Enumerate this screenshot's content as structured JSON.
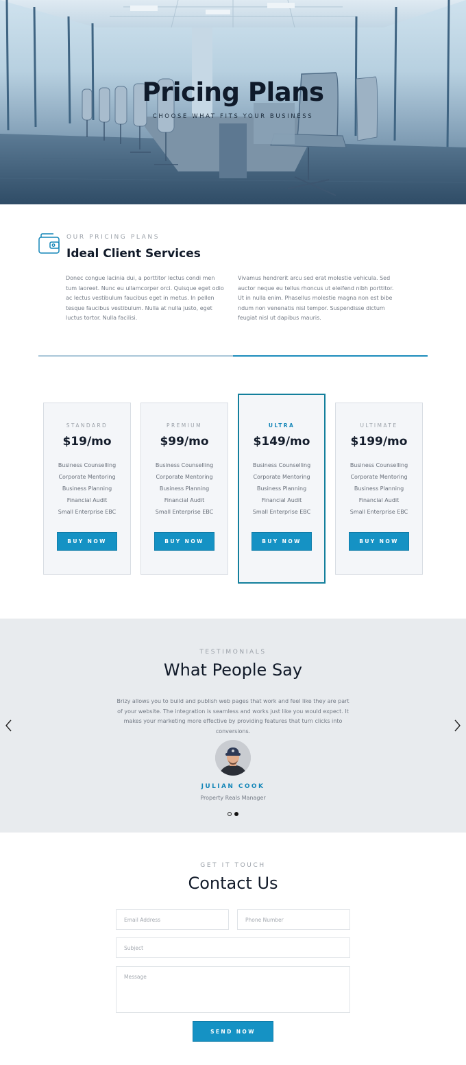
{
  "hero": {
    "title": "Pricing Plans",
    "subtitle": "CHOOSE WHAT FITS YOUR BUSINESS"
  },
  "services": {
    "icon": "wallet-icon",
    "eyebrow": "OUR PRICING PLANS",
    "title": "Ideal Client Services",
    "paragraph_left": "Donec congue lacinia dui, a porttitor lectus condi men tum laoreet. Nunc eu ullamcorper orci. Quisque eget odio ac lectus vestibulum faucibus eget in metus. In pellen tesque faucibus vestibulum. Nulla at nulla justo, eget luctus tortor. Nulla facilisi.",
    "paragraph_right": "Vivamus hendrerit arcu sed erat molestie vehicula. Sed auctor neque eu tellus rhoncus ut eleifend nibh porttitor. Ut in nulla enim. Phasellus molestie magna non est bibe ndum non venenatis nisl tempor. Suspendisse dictum feugiat nisl ut dapibus mauris."
  },
  "pricing": {
    "plans": [
      {
        "name": "STANDARD",
        "price": "$19/mo",
        "features": [
          "Business Counselling",
          "Corporate Mentoring",
          "Business Planning",
          "Financial Audit",
          "Small Enterprise EBC"
        ],
        "button": "BUY NOW"
      },
      {
        "name": "PREMIUM",
        "price": "$99/mo",
        "features": [
          "Business Counselling",
          "Corporate Mentoring",
          "Business Planning",
          "Financial Audit",
          "Small Enterprise EBC"
        ],
        "button": "BUY NOW"
      },
      {
        "name": "ULTRA",
        "price": "$149/mo",
        "features": [
          "Business Counselling",
          "Corporate Mentoring",
          "Business Planning",
          "Financial Audit",
          "Small Enterprise EBC"
        ],
        "button": "BUY NOW"
      },
      {
        "name": "ULTIMATE",
        "price": "$199/mo",
        "features": [
          "Business Counselling",
          "Corporate Mentoring",
          "Business Planning",
          "Financial Audit",
          "Small Enterprise EBC"
        ],
        "button": "BUY NOW"
      }
    ],
    "featured_plan": "ULTRA"
  },
  "testimonials": {
    "eyebrow": "TESTIMONIALS",
    "title": "What People Say",
    "quote": "Brizy allows you to build and publish web pages that work and feel like they are part of your website. The integration is seamless and works just like you would expect. It makes your marketing more effective by providing features that turn clicks into conversions.",
    "name": "JULIAN COOK",
    "role": "Property Reals Manager",
    "slides_total": 2,
    "slide_active": 2
  },
  "contact": {
    "eyebrow": "GET IT TOUCH",
    "title": "Contact Us",
    "email_placeholder": "Email Address",
    "phone_placeholder": "Phone Number",
    "subject_placeholder": "Subject",
    "message_placeholder": "Message",
    "send_label": "SEND NOW"
  },
  "colors": {
    "accent": "#1592c4",
    "featured_border": "#137f9c",
    "testimonial_bg": "#e8ebee",
    "card_bg": "#f4f6f9"
  }
}
